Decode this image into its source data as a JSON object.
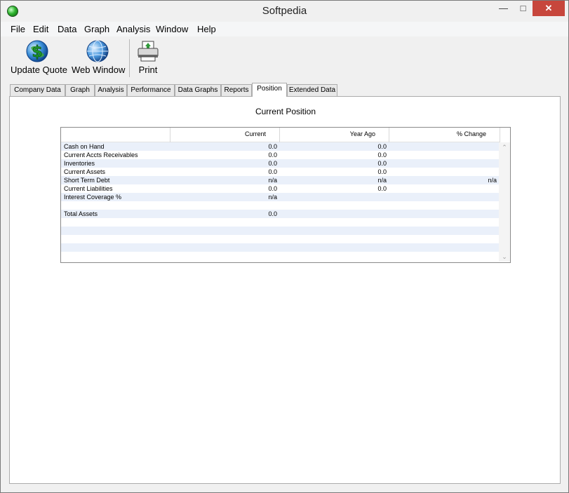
{
  "window": {
    "title": "Softpedia"
  },
  "menu": [
    "File",
    "Edit",
    "Data",
    "Graph",
    "Analysis",
    "Window",
    "Help"
  ],
  "toolbar": {
    "update_quote": "Update Quote",
    "web_window": "Web Window",
    "print": "Print"
  },
  "tabs": [
    "Company Data",
    "Graph",
    "Analysis",
    "Performance",
    "Data Graphs",
    "Reports",
    "Position",
    "Extended Data"
  ],
  "active_tab": "Position",
  "panel": {
    "title": "Current Position"
  },
  "grid": {
    "columns": [
      "",
      "Current",
      "Year Ago",
      "% Change"
    ],
    "rows": [
      [
        "Cash on Hand",
        "0.0",
        "0.0",
        ""
      ],
      [
        "Current Accts Receivables",
        "0.0",
        "0.0",
        ""
      ],
      [
        "Inventories",
        "0.0",
        "0.0",
        ""
      ],
      [
        "Current Assets",
        "0.0",
        "0.0",
        ""
      ],
      [
        "Short Term Debt",
        "n/a",
        "n/a",
        "n/a"
      ],
      [
        "Current Liabilities",
        "0.0",
        "0.0",
        ""
      ],
      [
        "Interest Coverage %",
        "n/a",
        "",
        ""
      ],
      [
        "",
        "",
        "",
        ""
      ],
      [
        "Total Assets",
        "0.0",
        "",
        ""
      ],
      [
        "",
        "",
        "",
        ""
      ],
      [
        "",
        "",
        "",
        ""
      ],
      [
        "",
        "",
        "",
        ""
      ],
      [
        "",
        "",
        "",
        ""
      ],
      [
        "",
        "",
        "",
        ""
      ]
    ]
  },
  "colors": {
    "row_alt": "#eaf0fa",
    "close_button": "#c7463c"
  }
}
